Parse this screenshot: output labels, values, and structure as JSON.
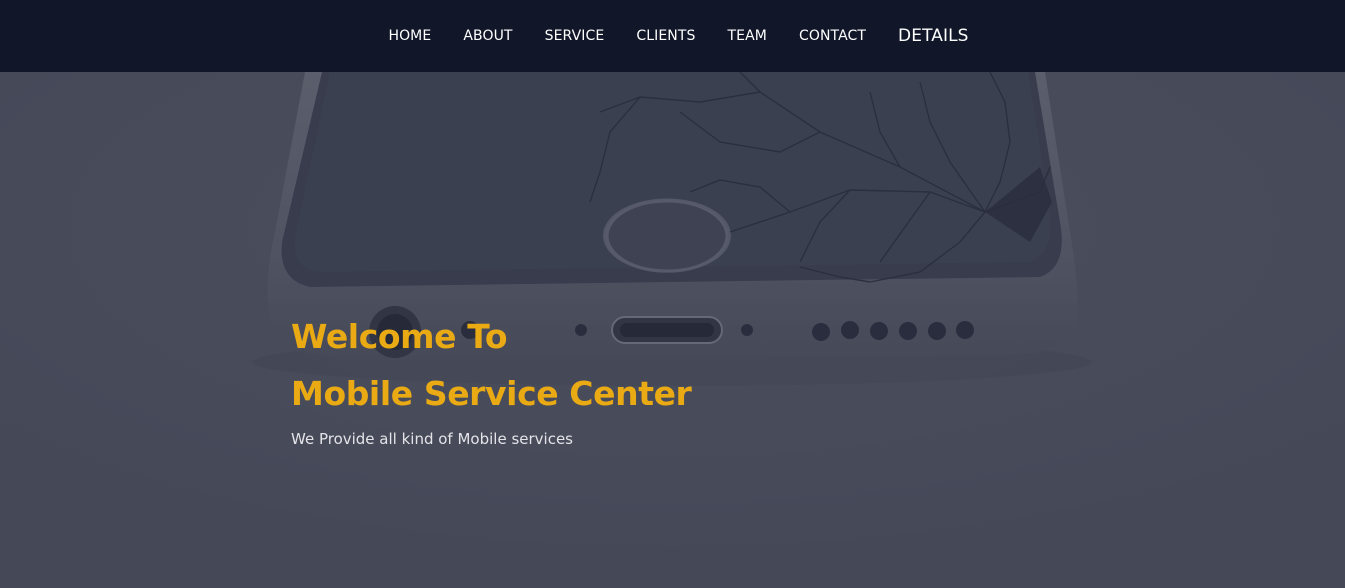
{
  "nav": {
    "items": [
      {
        "label": "HOME"
      },
      {
        "label": "ABOUT"
      },
      {
        "label": "SERVICE"
      },
      {
        "label": "CLIENTS"
      },
      {
        "label": "TEAM"
      },
      {
        "label": "CONTACT"
      },
      {
        "label": "DETAILS"
      }
    ]
  },
  "hero": {
    "title_line1": "Welcome To",
    "title_line2": "Mobile Service Center",
    "subtitle": "We Provide all kind of Mobile services",
    "background": "cracked-phone-photo"
  },
  "colors": {
    "navbar_bg": "#111729",
    "hero_overlay": "#4b4f5c",
    "accent": "#eaaa14",
    "text_light": "#e4e4e8"
  }
}
